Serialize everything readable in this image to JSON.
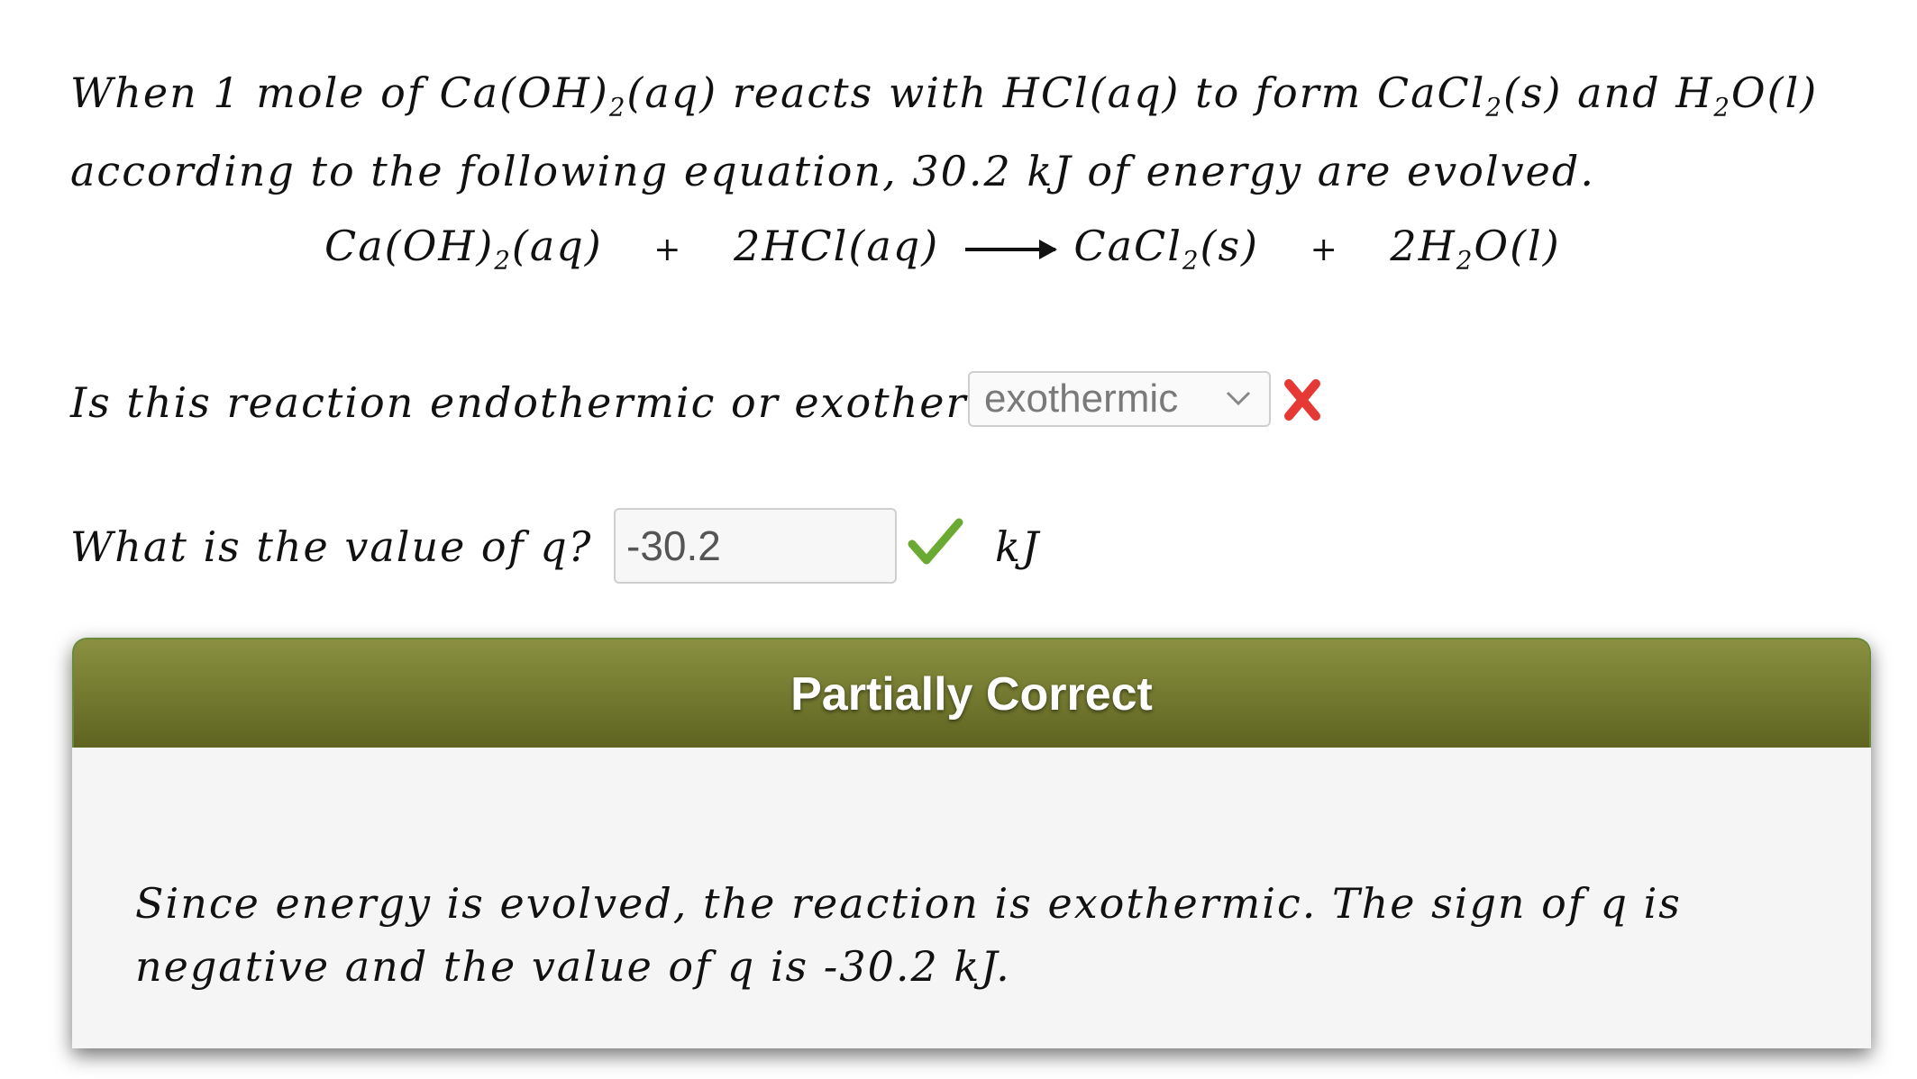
{
  "problem": {
    "line1": "When 1 mole of Ca(OH)",
    "sub1": "2",
    "line1b": "(aq) reacts with HCl(aq) to form CaCl",
    "sub2": "2",
    "line1c": "(s) and H",
    "sub3": "2",
    "line1d": "O(l)",
    "line2": "according to the following equation, 30.2 kJ of energy are evolved."
  },
  "equation": {
    "reactant1": "Ca(OH)",
    "reactant1_sub": "2",
    "reactant1_state": "(aq)",
    "plus": "+",
    "reactant2": "2HCl(aq)",
    "product1": "CaCl",
    "product1_sub": "2",
    "product1_state": "(s)",
    "product2_coef": "2H",
    "product2_sub": "2",
    "product2_rest": "O(l)"
  },
  "question1": {
    "text": "Is this reaction endothermic or exothermic?",
    "selected": "exothermic",
    "status": "incorrect"
  },
  "question2": {
    "text": "What is the value of q?",
    "value": "-30.2",
    "status": "correct",
    "unit": "kJ"
  },
  "feedback": {
    "title": "Partially Correct",
    "body": "Since energy is evolved, the reaction is exothermic. The sign of q is negative and the value of q is -30.2 kJ."
  },
  "colors": {
    "header_top": "#8a9040",
    "header_bottom": "#5e6420",
    "incorrect_mark": "#e53935",
    "correct_mark": "#6aaa32"
  }
}
